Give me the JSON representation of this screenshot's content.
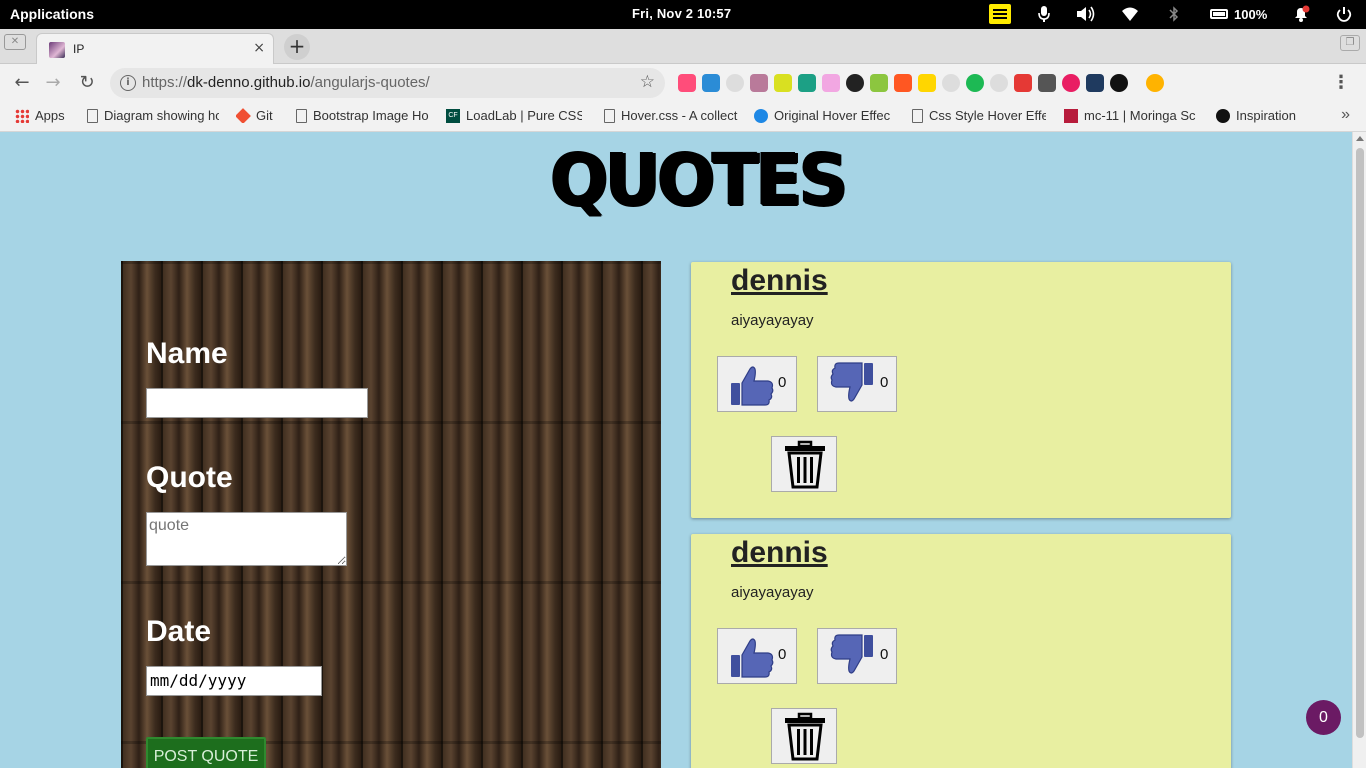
{
  "system": {
    "apps_label": "Applications",
    "clock": "Fri, Nov  2   10:57",
    "battery": "100%"
  },
  "tab": {
    "title": "IP",
    "close": "×",
    "new_tab": "+"
  },
  "omnibox": {
    "url_scheme": "https://",
    "url_host": "dk-denno.github.io",
    "url_path": "/angularjs-quotes/"
  },
  "bookmarks": [
    {
      "label": "Apps"
    },
    {
      "label": "Diagram showing ho"
    },
    {
      "label": "Git"
    },
    {
      "label": "Bootstrap Image Ho"
    },
    {
      "label": "LoadLab | Pure CSS"
    },
    {
      "label": "Hover.css - A collect"
    },
    {
      "label": "Original Hover Effec"
    },
    {
      "label": "Css Style Hover Effe"
    },
    {
      "label": "mc-11 | Moringa Sc"
    },
    {
      "label": "Inspiration"
    }
  ],
  "page": {
    "title": "QUOTES",
    "form": {
      "name_label": "Name",
      "name_value": "",
      "quote_label": "Quote",
      "quote_placeholder": "quote",
      "date_label": "Date",
      "date_value": "mm/dd/yyyy",
      "submit_label": "POST QUOTE"
    },
    "quotes": [
      {
        "author": "dennis",
        "text": "aiyayayayay",
        "upvotes": "0",
        "downvotes": "0"
      },
      {
        "author": "dennis",
        "text": "aiyayayayay",
        "upvotes": "0",
        "downvotes": "0"
      }
    ],
    "badge_count": "0"
  },
  "colors": {
    "page_bg": "#a6d4e5",
    "card_bg": "#e8efa1",
    "post_button": "#1d6e1d",
    "badge": "#6b1a64",
    "thumb_icon": "#4a5aa8"
  }
}
